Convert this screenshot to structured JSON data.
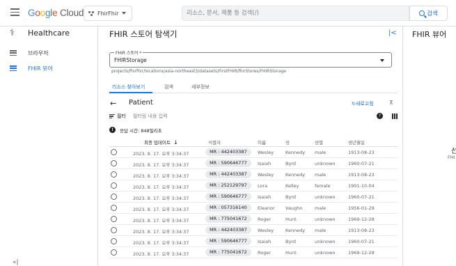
{
  "topbar": {
    "logo": {
      "g": "G",
      "o1": "o",
      "o2": "o",
      "g2": "g",
      "l": "l",
      "e": "e",
      "cloud": "Cloud"
    },
    "project": "FhirFhir",
    "search_placeholder": "리소스, 문서, 제품 등 검색(/)",
    "search_button": "검색"
  },
  "leftnav": {
    "title": "Healthcare",
    "items": [
      {
        "label": "브라우저",
        "active": false
      },
      {
        "label": "FHIR 뷰어",
        "active": true
      }
    ],
    "bottom_glyph": "«|"
  },
  "main": {
    "title": "FHIR 스토어 탐색기",
    "collapse": "|<",
    "store_select": {
      "label": "FHIR 스토어 *",
      "value": "FHIRStorage"
    },
    "store_path": "projects/fhirfhir/locations/asia-northeast3/datasets/FirstFHIR/fhirStores/FHIRStorage",
    "tabs": [
      {
        "label": "리소스 찾아보기",
        "active": true
      },
      {
        "label": "검색",
        "active": false
      },
      {
        "label": "세부정보",
        "active": false
      }
    ],
    "resource": {
      "back": "←",
      "title": "Patient",
      "refresh": "새로고침"
    },
    "filter": {
      "label": "필터",
      "placeholder": "필터링 내용 입력"
    },
    "response_time": "응답 시간: 848밀리초",
    "columns": [
      "최종 업데이트",
      "식별자",
      "이름",
      "성",
      "성별",
      "생년월일"
    ],
    "rows": [
      {
        "updated": "2023. 8. 17. 오후 3:34:37",
        "id": "MR : 442403387",
        "first": "Wesley",
        "last": "Kennedy",
        "gender": "male",
        "birth": "1913-08-23"
      },
      {
        "updated": "2023. 8. 17. 오후 3:34:37",
        "id": "MR : 590646777",
        "first": "Isaiah",
        "last": "Byrd",
        "gender": "unknown",
        "birth": "1960-07-21"
      },
      {
        "updated": "2023. 8. 17. 오후 3:34:37",
        "id": "MR : 442403387",
        "first": "Wesley",
        "last": "Kennedy",
        "gender": "male",
        "birth": "1913-08-23"
      },
      {
        "updated": "2023. 8. 17. 오후 3:34:37",
        "id": "MR : 252129797",
        "first": "Lora",
        "last": "Kelley",
        "gender": "female",
        "birth": "1901-10-04"
      },
      {
        "updated": "2023. 8. 17. 오후 3:34:37",
        "id": "MR : 590646777",
        "first": "Isaiah",
        "last": "Byrd",
        "gender": "unknown",
        "birth": "1960-07-21"
      },
      {
        "updated": "2023. 8. 17. 오후 3:34:37",
        "id": "MR : 057316140",
        "first": "Eleanor",
        "last": "Vaughn",
        "gender": "male",
        "birth": "1956-01-29"
      },
      {
        "updated": "2023. 8. 17. 오후 3:34:37",
        "id": "MR : 775041672",
        "first": "Roger",
        "last": "Hunt",
        "gender": "unknown",
        "birth": "1969-12-28"
      },
      {
        "updated": "2023. 8. 17. 오후 3:34:37",
        "id": "MR : 442403387",
        "first": "Wesley",
        "last": "Kennedy",
        "gender": "male",
        "birth": "1913-08-23"
      },
      {
        "updated": "2023. 8. 17. 오후 3:34:37",
        "id": "MR : 590646777",
        "first": "Isaiah",
        "last": "Byrd",
        "gender": "unknown",
        "birth": "1960-07-21"
      },
      {
        "updated": "2023. 8. 17. 오후 3:34:37",
        "id": "MR : 775041672",
        "first": "Roger",
        "last": "Hunt",
        "gender": "unknown",
        "birth": "1969-12-28"
      }
    ]
  },
  "rightpanel": {
    "title": "FHIR 뷰어",
    "select_fragment": "선",
    "sub_fragment": "FHI"
  },
  "colors": {
    "accent": "#1a73e8",
    "text": "#202124",
    "muted": "#5f6368",
    "border": "#dadce0"
  },
  "icons": [
    "menu-icon",
    "project-icon",
    "search-icon",
    "healthcare-icon",
    "list-icon",
    "collapse-icon",
    "back-arrow-icon",
    "refresh-icon",
    "pin-icon",
    "filter-icon",
    "help-icon",
    "columns-icon",
    "info-icon",
    "sort-down-icon"
  ]
}
